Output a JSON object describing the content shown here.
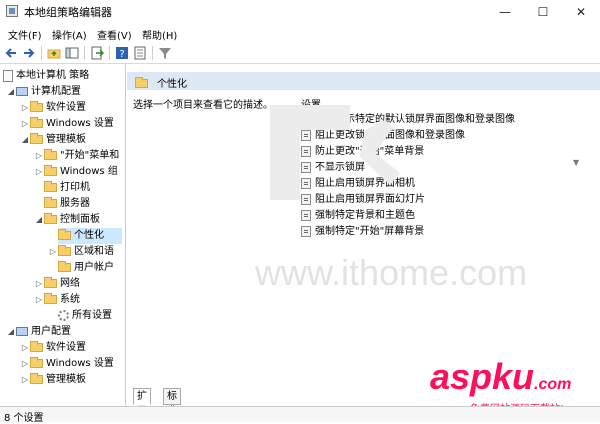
{
  "window": {
    "title": "本地组策略编辑器",
    "controls": {
      "minimize": "—",
      "maximize": "☐",
      "close": "✕"
    }
  },
  "menu": [
    "文件(F)",
    "操作(A)",
    "查看(V)",
    "帮助(H)"
  ],
  "toolbar": {
    "icons": [
      "back-arrow-icon",
      "forward-arrow-icon",
      "up-folder-icon",
      "show-hide-tree-icon",
      "export-list-icon",
      "help-icon",
      "properties-icon",
      "filter-icon"
    ]
  },
  "tree": {
    "root": "本地计算机 策略",
    "items": [
      {
        "label": "计算机配置"
      },
      {
        "label": "软件设置"
      },
      {
        "label": "Windows 设置"
      },
      {
        "label": "管理模板"
      },
      {
        "label": "\"开始\"菜单和"
      },
      {
        "label": "Windows 组"
      },
      {
        "label": "打印机"
      },
      {
        "label": "服务器"
      },
      {
        "label": "控制面板"
      },
      {
        "label": "个性化"
      },
      {
        "label": "区域和语"
      },
      {
        "label": "用户帐户"
      },
      {
        "label": "网络"
      },
      {
        "label": "系统"
      },
      {
        "label": "所有设置"
      },
      {
        "label": "用户配置"
      },
      {
        "label": "软件设置"
      },
      {
        "label": "Windows 设置"
      },
      {
        "label": "管理模板"
      }
    ]
  },
  "detail": {
    "header": "个性化",
    "description": "选择一个项目来查看它的描述。",
    "settings_column": "设置",
    "settings": [
      "强制显示特定的默认锁屏界面图像和登录图像",
      "阻止更改锁屏界面图像和登录图像",
      "防止更改\"开始\"菜单背景",
      "不显示锁屏",
      "阻止启用锁屏界面相机",
      "阻止启用锁屏界面幻灯片",
      "强制特定背景和主题色",
      "强制特定\"开始\"屏幕背景"
    ]
  },
  "tabs": [
    "扩展",
    "标准"
  ],
  "status": "8 个设置",
  "watermark": {
    "site": "www.ithome.com",
    "brand": "aspku",
    "brand_suffix": ".com",
    "caption": "免费网站源码下载站!"
  },
  "colors": {
    "selection": "#cce8ff",
    "header_strip": "#dde8f5",
    "watermark_brand": "#ff0f5a"
  }
}
